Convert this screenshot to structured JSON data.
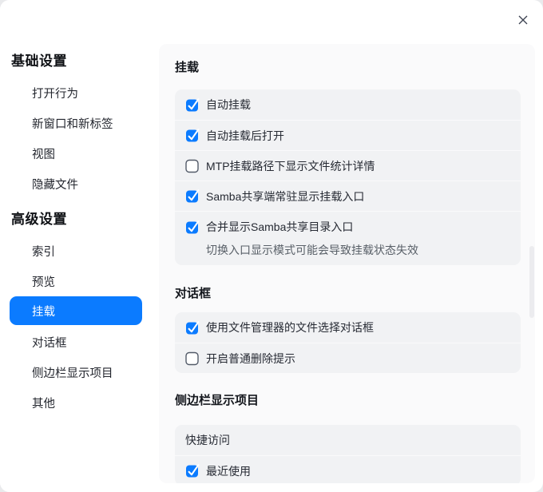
{
  "window": {
    "close_icon": "close"
  },
  "colors": {
    "accent": "#0b7bff",
    "panel_bg": "#fafafb",
    "group_bg": "#f1f2f4"
  },
  "sidebar": {
    "groups": [
      {
        "header": "基础设置",
        "items": [
          {
            "label": "打开行为",
            "selected": false
          },
          {
            "label": "新窗口和新标签",
            "selected": false
          },
          {
            "label": "视图",
            "selected": false
          },
          {
            "label": "隐藏文件",
            "selected": false
          }
        ]
      },
      {
        "header": "高级设置",
        "items": [
          {
            "label": "索引",
            "selected": false
          },
          {
            "label": "预览",
            "selected": false
          },
          {
            "label": "挂载",
            "selected": true
          },
          {
            "label": "对话框",
            "selected": false
          },
          {
            "label": "侧边栏显示项目",
            "selected": false
          },
          {
            "label": "其他",
            "selected": false
          }
        ]
      }
    ]
  },
  "content": {
    "sections": [
      {
        "title": "挂载",
        "rows": [
          {
            "type": "checkbox",
            "checked": true,
            "label": "自动挂载"
          },
          {
            "type": "checkbox",
            "checked": true,
            "label": "自动挂载后打开"
          },
          {
            "type": "checkbox",
            "checked": false,
            "label": "MTP挂载路径下显示文件统计详情"
          },
          {
            "type": "checkbox",
            "checked": true,
            "label": "Samba共享端常驻显示挂载入口"
          },
          {
            "type": "checkbox",
            "checked": true,
            "label": "合并显示Samba共享目录入口",
            "hint": "切换入口显示模式可能会导致挂载状态失效"
          }
        ]
      },
      {
        "title": "对话框",
        "rows": [
          {
            "type": "checkbox",
            "checked": true,
            "label": "使用文件管理器的文件选择对话框"
          },
          {
            "type": "checkbox",
            "checked": false,
            "label": "开启普通删除提示"
          }
        ]
      },
      {
        "title": "侧边栏显示项目",
        "rows": [
          {
            "type": "label",
            "label": "快捷访问"
          },
          {
            "type": "checkbox",
            "checked": true,
            "label": "最近使用"
          }
        ]
      }
    ]
  }
}
